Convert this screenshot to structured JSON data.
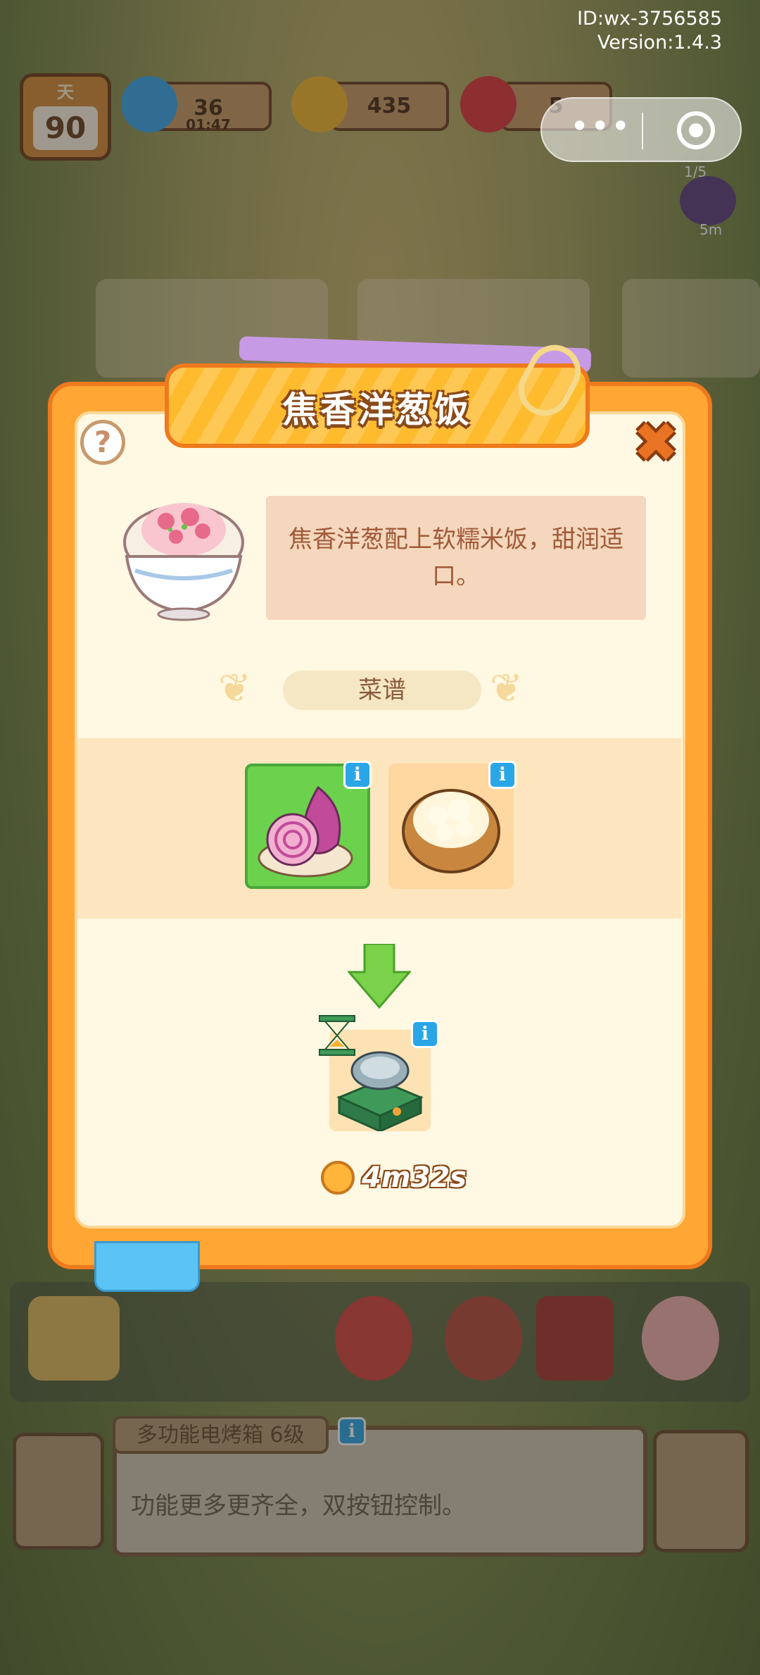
{
  "header": {
    "id_text": "ID:wx-3756585",
    "version_text": "Version:1.4.3"
  },
  "hud": {
    "day_label": "天",
    "day_value": "90",
    "energy_value": "36",
    "energy_timer": "01:47",
    "coins_value": "435",
    "gems_value": "5"
  },
  "side": {
    "counter": "1/5",
    "timer": "5m"
  },
  "modal": {
    "title": "焦香洋葱饭",
    "help_label": "?",
    "description": "焦香洋葱配上软糯米饭，甜润适口。",
    "recipe_tab": "菜谱",
    "cook_time": "4m32s",
    "info_badge": "i"
  },
  "bottom": {
    "item_title": "多功能电烤箱 6级",
    "item_desc": "功能更多更齐全，双按钮控制。"
  },
  "colors": {
    "modal_orange": "#ffa634",
    "modal_inner": "#fff8e2",
    "title_text": "#ffffff",
    "info_blue": "#2aa6e6"
  }
}
